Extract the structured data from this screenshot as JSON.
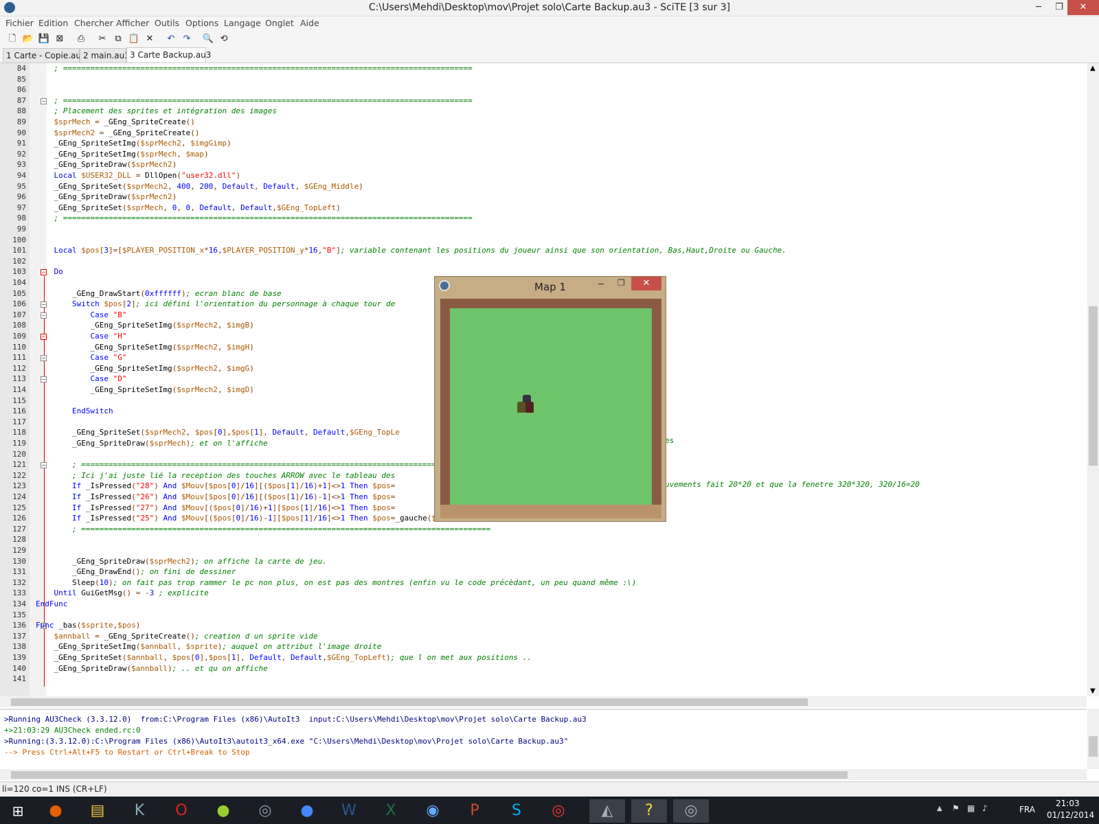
{
  "window": {
    "title": "C:\\Users\\Mehdi\\Desktop\\mov\\Projet solo\\Carte Backup.au3 - SciTE [3 sur 3]",
    "min_icon": "minimize-icon",
    "max_icon": "maximize-icon",
    "close_icon": "close-icon"
  },
  "menu": [
    "Fichier",
    "Edition",
    "Chercher",
    "Afficher",
    "Outils",
    "Options",
    "Langage",
    "Onglet",
    "Aide"
  ],
  "toolbar": [
    "new-icon",
    "open-icon",
    "save-icon",
    "close-file-icon",
    "print-icon",
    "cut-icon",
    "copy-icon",
    "paste-icon",
    "delete-icon",
    "undo-icon",
    "redo-icon",
    "find-icon",
    "replace-icon"
  ],
  "tabs": [
    {
      "label": "1 Carte - Copie.au3"
    },
    {
      "label": "2 main.au3"
    },
    {
      "label": "3 Carte Backup.au3",
      "active": true
    }
  ],
  "editor": {
    "lines": [
      {
        "n": "84",
        "text": "    ; ==========================================================================================",
        "c": "cm"
      },
      {
        "n": "85",
        "text": "",
        "c": ""
      },
      {
        "n": "86",
        "text": "",
        "c": ""
      },
      {
        "n": "87",
        "text": "    ; ==========================================================================================",
        "c": "cm",
        "fold": "minus"
      },
      {
        "n": "88",
        "text": "    ; Placement des sprites et intégration des images",
        "c": "cm"
      },
      {
        "n": "89",
        "text": "    $sprMech = _GEng_SpriteCreate()",
        "c": ""
      },
      {
        "n": "90",
        "text": "    $sprMech2 = _GEng_SpriteCreate()",
        "c": ""
      },
      {
        "n": "91",
        "text": "    _GEng_SpriteSetImg($sprMech2, $imgGimp)",
        "c": ""
      },
      {
        "n": "92",
        "text": "    _GEng_SpriteSetImg($sprMech, $map)",
        "c": ""
      },
      {
        "n": "93",
        "text": "    _GEng_SpriteDraw($sprMech2)",
        "c": ""
      },
      {
        "n": "94",
        "text": "    Local $USER32_DLL = DllOpen(\"user32.dll\")",
        "c": ""
      },
      {
        "n": "95",
        "text": "    _GEng_SpriteSet($sprMech2, 400, 200, Default, Default, $GEng_Middle)",
        "c": ""
      },
      {
        "n": "96",
        "text": "    _GEng_SpriteDraw($sprMech2)",
        "c": ""
      },
      {
        "n": "97",
        "text": "    _GEng_SpriteSet($sprMech, 0, 0, Default, Default,$GEng_TopLeft)",
        "c": ""
      },
      {
        "n": "98",
        "text": "    ; ==========================================================================================",
        "c": "cm"
      },
      {
        "n": "99",
        "text": "",
        "c": ""
      },
      {
        "n": "100",
        "text": "",
        "c": ""
      },
      {
        "n": "101",
        "text": "    Local $pos[3]=[$PLAYER_POSITION_x*16,$PLAYER_POSITION_y*16,\"B\"]; variable contenant les positions du joueur ainsi que son orientation, Bas,Haut,Droite ou Gauche.",
        "c": ""
      },
      {
        "n": "102",
        "text": "",
        "c": ""
      },
      {
        "n": "103",
        "text": "    Do",
        "c": "kw",
        "fold": "red"
      },
      {
        "n": "104",
        "text": "",
        "c": ""
      },
      {
        "n": "105",
        "text": "        _GEng_DrawStart(0xffffff); ecran blanc de base",
        "c": ""
      },
      {
        "n": "106",
        "text": "        Switch $pos[2]; ici défini l'orientation du personnage à chaque tour de",
        "c": "",
        "fold": "minus"
      },
      {
        "n": "107",
        "text": "            Case \"B\"",
        "c": "",
        "fold": "minus"
      },
      {
        "n": "108",
        "text": "            _GEng_SpriteSetImg($sprMech2, $imgB)",
        "c": ""
      },
      {
        "n": "109",
        "text": "            Case \"H\"",
        "c": "",
        "fold": "red"
      },
      {
        "n": "110",
        "text": "            _GEng_SpriteSetImg($sprMech2, $imgH)",
        "c": ""
      },
      {
        "n": "111",
        "text": "            Case \"G\"",
        "c": "",
        "fold": "minus"
      },
      {
        "n": "112",
        "text": "            _GEng_SpriteSetImg($sprMech2, $imgG)",
        "c": ""
      },
      {
        "n": "113",
        "text": "            Case \"D\"",
        "c": "",
        "fold": "minus"
      },
      {
        "n": "114",
        "text": "            _GEng_SpriteSetImg($sprMech2, $imgD)",
        "c": ""
      },
      {
        "n": "115",
        "text": "",
        "c": ""
      },
      {
        "n": "116",
        "text": "        EndSwitch",
        "c": "kw"
      },
      {
        "n": "117",
        "text": "",
        "c": ""
      },
      {
        "n": "118",
        "text": "        _GEng_SpriteSet($sprMech2, $pos[0],$pos[1], Default, Default,$GEng_TopLe",
        "c": ""
      },
      {
        "n": "119",
        "text": "        _GEng_SpriteDraw($sprMech); et on l'affiche",
        "c": ""
      },
      {
        "n": "120",
        "text": "",
        "c": ""
      },
      {
        "n": "121",
        "text": "        ; ==========================================================================================",
        "c": "cm",
        "fold": "minus"
      },
      {
        "n": "122",
        "text": "        ; Ici j'ai juste lié la reception des touches ARROW avec le tableau des",
        "c": "cm"
      },
      {
        "n": "123",
        "text": "        If _IsPressed(\"28\") And $Mouv[$pos[0]/16][($pos[1]/16)+1]<>1 Then $pos=",
        "c": ""
      },
      {
        "n": "124",
        "text": "        If _IsPressed(\"26\") And $Mouv[$pos[0]/16][($pos[1]/16)-1]<>1 Then $pos=",
        "c": ""
      },
      {
        "n": "125",
        "text": "        If _IsPressed(\"27\") And $Mouv[($pos[0]/16)+1][$pos[1]/16]<>1 Then $pos=",
        "c": ""
      },
      {
        "n": "126",
        "text": "        If _IsPressed(\"25\") And $Mouv[($pos[0]/16)-1][$pos[1]/16]<>1 Then $pos=_gauche($imgG,$pos)",
        "c": ""
      },
      {
        "n": "127",
        "text": "        ; ==========================================================================================",
        "c": "cm"
      },
      {
        "n": "128",
        "text": "",
        "c": ""
      },
      {
        "n": "129",
        "text": "",
        "c": ""
      },
      {
        "n": "130",
        "text": "        _GEng_SpriteDraw($sprMech2); on affiche la carte de jeu.",
        "c": ""
      },
      {
        "n": "131",
        "text": "        _GEng_DrawEnd(); on fini de dessiner",
        "c": ""
      },
      {
        "n": "132",
        "text": "        Sleep(10); on fait pas trop rammer le pc non plus, on est pas des montres (enfin vu le code précèdant, un peu quand même :\\)",
        "c": ""
      },
      {
        "n": "133",
        "text": "    Until GuiGetMsg() = -3 ; explicite",
        "c": ""
      },
      {
        "n": "134",
        "text": "EndFunc",
        "c": "kw"
      },
      {
        "n": "135",
        "text": "",
        "c": ""
      },
      {
        "n": "136",
        "text": "Func _bas($sprite,$pos)",
        "c": "",
        "fold": "minus"
      },
      {
        "n": "137",
        "text": "    $annball = _GEng_SpriteCreate(); creation d un sprite vide",
        "c": ""
      },
      {
        "n": "138",
        "text": "    _GEng_SpriteSetImg($annball, $sprite); auquel on attribut l'image droite",
        "c": ""
      },
      {
        "n": "139",
        "text": "    _GEng_SpriteSet($annball, $pos[0],$pos[1], Default, Default,$GEng_TopLeft); que l on met aux positions ..",
        "c": ""
      },
      {
        "n": "140",
        "text": "    _GEng_SpriteDraw($annball); .. et qu on affiche",
        "c": ""
      },
      {
        "n": "141",
        "text": "",
        "c": ""
      }
    ],
    "overflow_118": "es",
    "overflow_122": "uvements fait 20*20 et que la fenetre 320*320, 320/16=20"
  },
  "output": [
    {
      "text": ">Running AU3Check (3.3.12.0)  from:C:\\Program Files (x86)\\AutoIt3  input:C:\\Users\\Mehdi\\Desktop\\mov\\Projet solo\\Carte Backup.au3",
      "color": "#00007f"
    },
    {
      "text": "+>21:03:29 AU3Check ended.rc:0",
      "color": "#007f00"
    },
    {
      "text": ">Running:(3.3.12.0):C:\\Program Files (x86)\\AutoIt3\\autoit3_x64.exe \"C:\\Users\\Mehdi\\Desktop\\mov\\Projet solo\\Carte Backup.au3\"",
      "color": "#00007f"
    },
    {
      "text": "--> Press Ctrl+Alt+F5 to Restart or Ctrl+Break to Stop",
      "color": "#d06000"
    }
  ],
  "status": "li=120 co=1 INS (CR+LF)",
  "map_window": {
    "title": "Map 1"
  },
  "taskbar": {
    "apps": [
      "windows-start-icon",
      "firefox-icon",
      "file-explorer-icon",
      "k-app-icon",
      "opera-icon",
      "gourd-app-icon",
      "autoit-icon",
      "globe-app-icon",
      "word-icon",
      "excel-icon",
      "google-earth-icon",
      "powerpoint-icon",
      "skype-icon",
      "target-app-icon",
      "scite-icon",
      "help-icon",
      "autoit-running-icon"
    ],
    "lang": "FRA",
    "time": "21:03",
    "date": "01/12/2014"
  },
  "colors": {
    "comment": "#007f00",
    "keyword": "#0000ff",
    "string": "#7f007f",
    "number": "#0000ff",
    "variable": "#aa5a00",
    "macro": "#ff0000"
  }
}
